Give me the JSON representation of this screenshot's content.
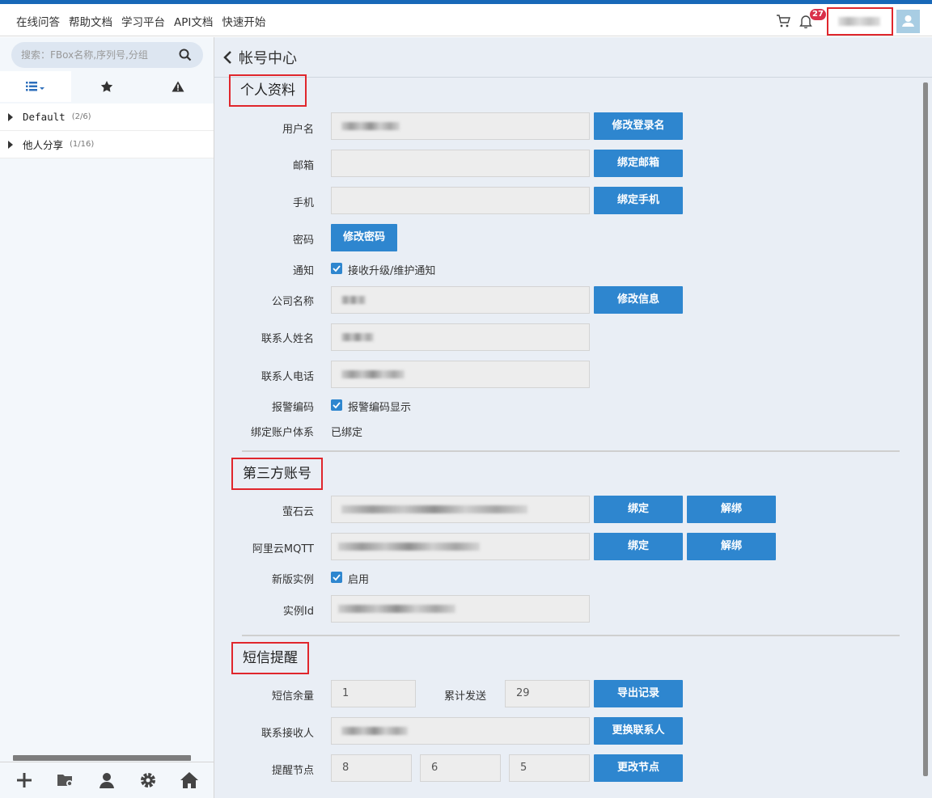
{
  "topnav": [
    "在线问答",
    "帮助文档",
    "学习平台",
    "API文档",
    "快速开始"
  ],
  "header": {
    "notification_count": "27",
    "cart_icon": "cart-icon",
    "bell_icon": "bell-icon",
    "avatar_icon": "user-icon"
  },
  "sidebar": {
    "search_placeholder": "搜索：FBox名称,序列号,分组",
    "tabs": [
      "list-icon",
      "star-icon",
      "warning-icon"
    ],
    "groups": [
      {
        "name": "Default",
        "count": "(2/6)"
      },
      {
        "name": "他人分享",
        "count": "(1/16)"
      }
    ],
    "footer_icons": [
      "plus-icon",
      "folder-settings-icon",
      "user-icon",
      "gear-icon",
      "home-icon"
    ]
  },
  "page": {
    "title": "帐号中心"
  },
  "profile": {
    "section_title": "个人资料",
    "username_label": "用户名",
    "username_value": "xiaozhu",
    "change_login_button": "修改登录名",
    "email_label": "邮箱",
    "bind_email_button": "绑定邮箱",
    "phone_label": "手机",
    "bind_phone_button": "绑定手机",
    "password_label": "密码",
    "change_password_button": "修改密码",
    "notify_label": "通知",
    "notify_checkbox": "接收升级/维护通知",
    "company_label": "公司名称",
    "change_info_button": "修改信息",
    "contact_name_label": "联系人姓名",
    "contact_phone_label": "联系人电话",
    "alarm_code_label": "报警编码",
    "alarm_code_checkbox": "报警编码显示",
    "bound_system_label": "绑定账户体系",
    "bound_system_value": "已绑定"
  },
  "third_party": {
    "section_title": "第三方账号",
    "ezviz_label": "萤石云",
    "aliyun_label": "阿里云MQTT",
    "bind_button": "绑定",
    "unbind_button": "解绑",
    "new_instance_label": "新版实例",
    "new_instance_checkbox": "启用",
    "instance_id_label": "实例Id"
  },
  "sms": {
    "section_title": "短信提醒",
    "balance_label": "短信余量",
    "balance_value": "1",
    "sent_label": "累计发送",
    "sent_value": "29",
    "export_button": "导出记录",
    "receiver_label": "联系接收人",
    "change_contact_button": "更换联系人",
    "nodes_label": "提醒节点",
    "nodes": [
      "8",
      "6",
      "5"
    ],
    "change_nodes_button": "更改节点"
  }
}
